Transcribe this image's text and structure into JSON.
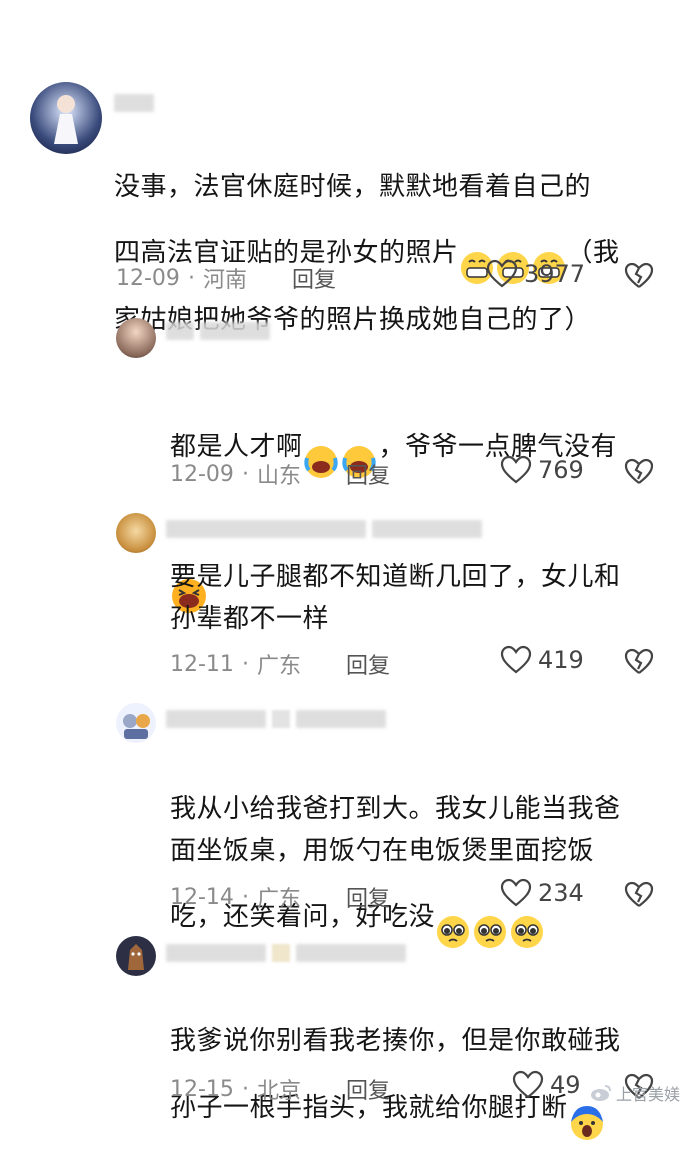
{
  "comments": [
    {
      "text": "没事，法官休庭时候，默默地看着自己的\n四高法官证贴的是孙女的照片",
      "text_tail": "（我\n家姑娘把她爷爷的照片换成她自己的了）",
      "date": "12-09",
      "region": "河南",
      "reply": "回复",
      "likes": "3977"
    },
    {
      "text": "都是人才啊",
      "text_tail": "，爷爷一点脾气没有",
      "date": "12-09",
      "region": "山东",
      "reply": "回复",
      "likes": "769"
    },
    {
      "text": "要是儿子腿都不知道断几回了，女儿和\n孙辈都不一样",
      "date": "12-11",
      "region": "广东",
      "reply": "回复",
      "likes": "419"
    },
    {
      "text": "我从小给我爸打到大。我女儿能当我爸\n面坐饭桌，用饭勺在电饭煲里面挖饭\n吃，还笑着问，好吃没",
      "date": "12-14",
      "region": "广东",
      "reply": "回复",
      "likes": "234"
    },
    {
      "text": "我爹说你别看我老揍你，但是你敢碰我\n孙子一根手指头，我就给你腿打断",
      "date": "12-15",
      "region": "北京",
      "reply": "回复",
      "likes": "49"
    }
  ],
  "separator": "·",
  "watermark": "上官美媄",
  "icons": {
    "like": "heart-outline-icon",
    "dislike": "broken-heart-icon"
  },
  "colors": {
    "meta": "#8a8a8a",
    "text": "#151515",
    "icon": "#444444"
  }
}
